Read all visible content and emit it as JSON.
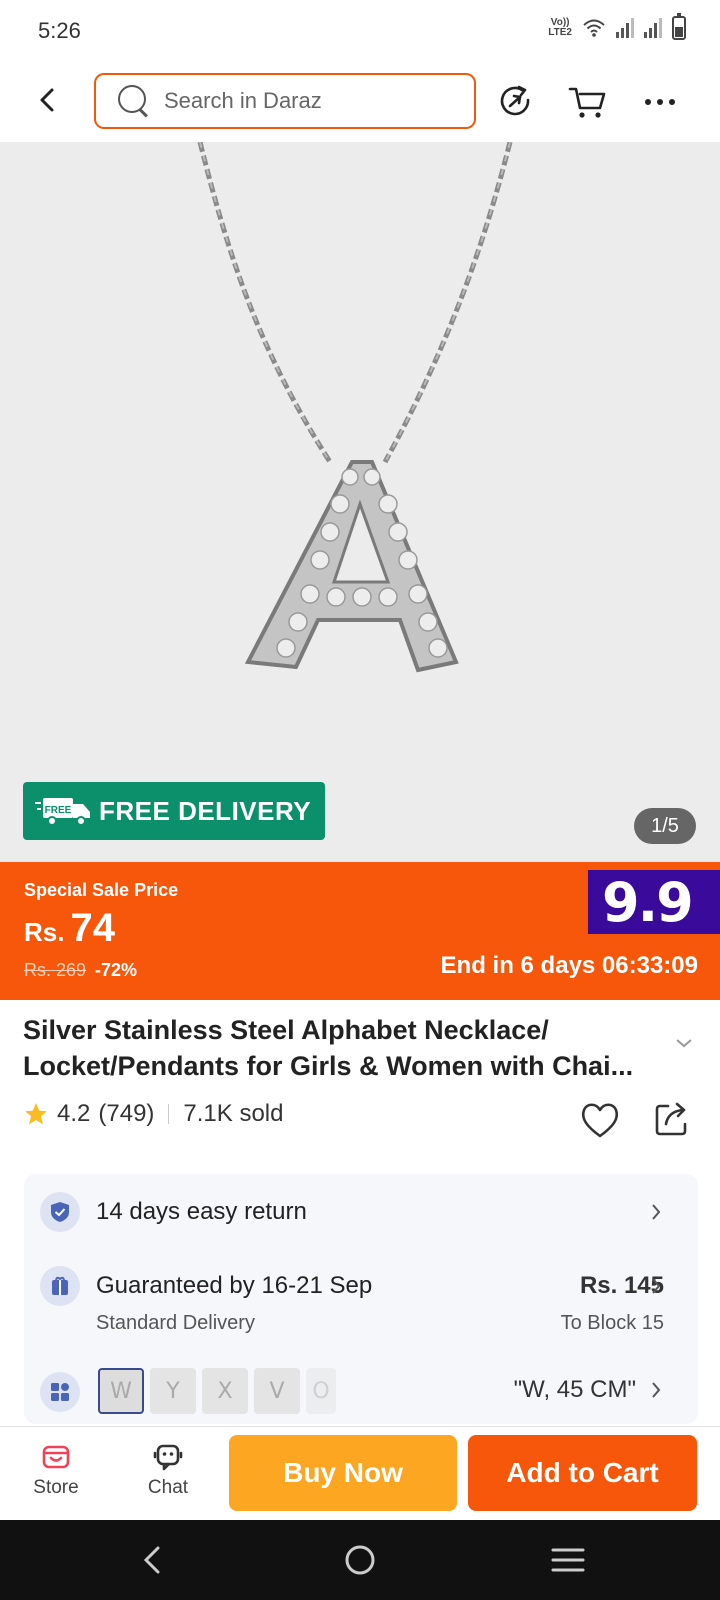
{
  "status_bar": {
    "time": "5:26",
    "network": "Vo)) LTE2"
  },
  "header": {
    "search_placeholder": "Search in Daraz",
    "icons": [
      "back-icon",
      "share-arrow-icon",
      "cart-icon",
      "more-icon"
    ]
  },
  "gallery": {
    "badge_small": "FREE",
    "badge_label": "FREE DELIVERY",
    "counter": "1/5",
    "image_subject": "Silver letter A pendant necklace"
  },
  "sale": {
    "label": "Special Sale Price",
    "currency": "Rs.",
    "price": "74",
    "original_price": "Rs. 269",
    "discount": "-72%",
    "campaign": "9.9",
    "ends": "End in 6 days 06:33:09"
  },
  "product": {
    "title": "Silver Stainless Steel Alphabet Necklace/ Locket/Pendants for Girls & Women with Chai...",
    "rating": "4.2",
    "reviews": "(749)",
    "sold": "7.1K sold"
  },
  "info": {
    "return_text": "14 days easy return",
    "delivery_text": "Guaranteed by 16-21 Sep",
    "delivery_sub": "Standard Delivery",
    "delivery_price": "Rs. 145",
    "delivery_location": "To Block 15",
    "variant_value": "\"W, 45 CM\"",
    "variant_thumbs": [
      "W",
      "Y",
      "X",
      "V",
      "O"
    ]
  },
  "actions": {
    "store": "Store",
    "chat": "Chat",
    "buy_now": "Buy Now",
    "add_to_cart": "Add to Cart"
  },
  "colors": {
    "brand_orange": "#f7570a",
    "buy_yellow": "#fca622",
    "free_green": "#0c8f6b",
    "campaign_purple": "#3a0a9a"
  }
}
